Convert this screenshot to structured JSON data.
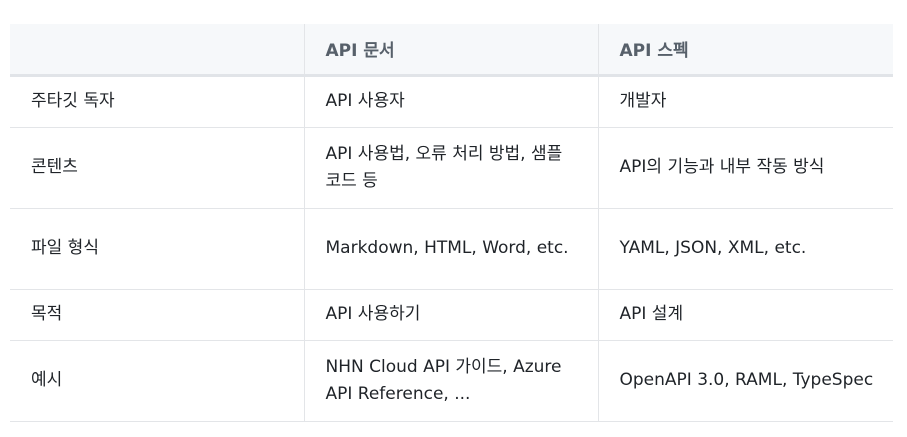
{
  "table": {
    "headers": [
      "",
      "API 문서",
      "API 스펙"
    ],
    "rows": [
      [
        "주타깃 독자",
        "API 사용자",
        "개발자"
      ],
      [
        "콘텐츠",
        "API 사용법, 오류 처리 방법, 샘플 코드 등",
        "API의 기능과 내부 작동 방식"
      ],
      [
        "파일 형식",
        "Markdown,  HTML, Word, etc.",
        "YAML, JSON, XML, etc."
      ],
      [
        "목적",
        "API 사용하기",
        "API 설계"
      ],
      [
        "예시",
        "NHN Cloud API 가이드, Azure API Reference, ...",
        "OpenAPI 3.0, RAML, TypeSpec"
      ]
    ]
  }
}
